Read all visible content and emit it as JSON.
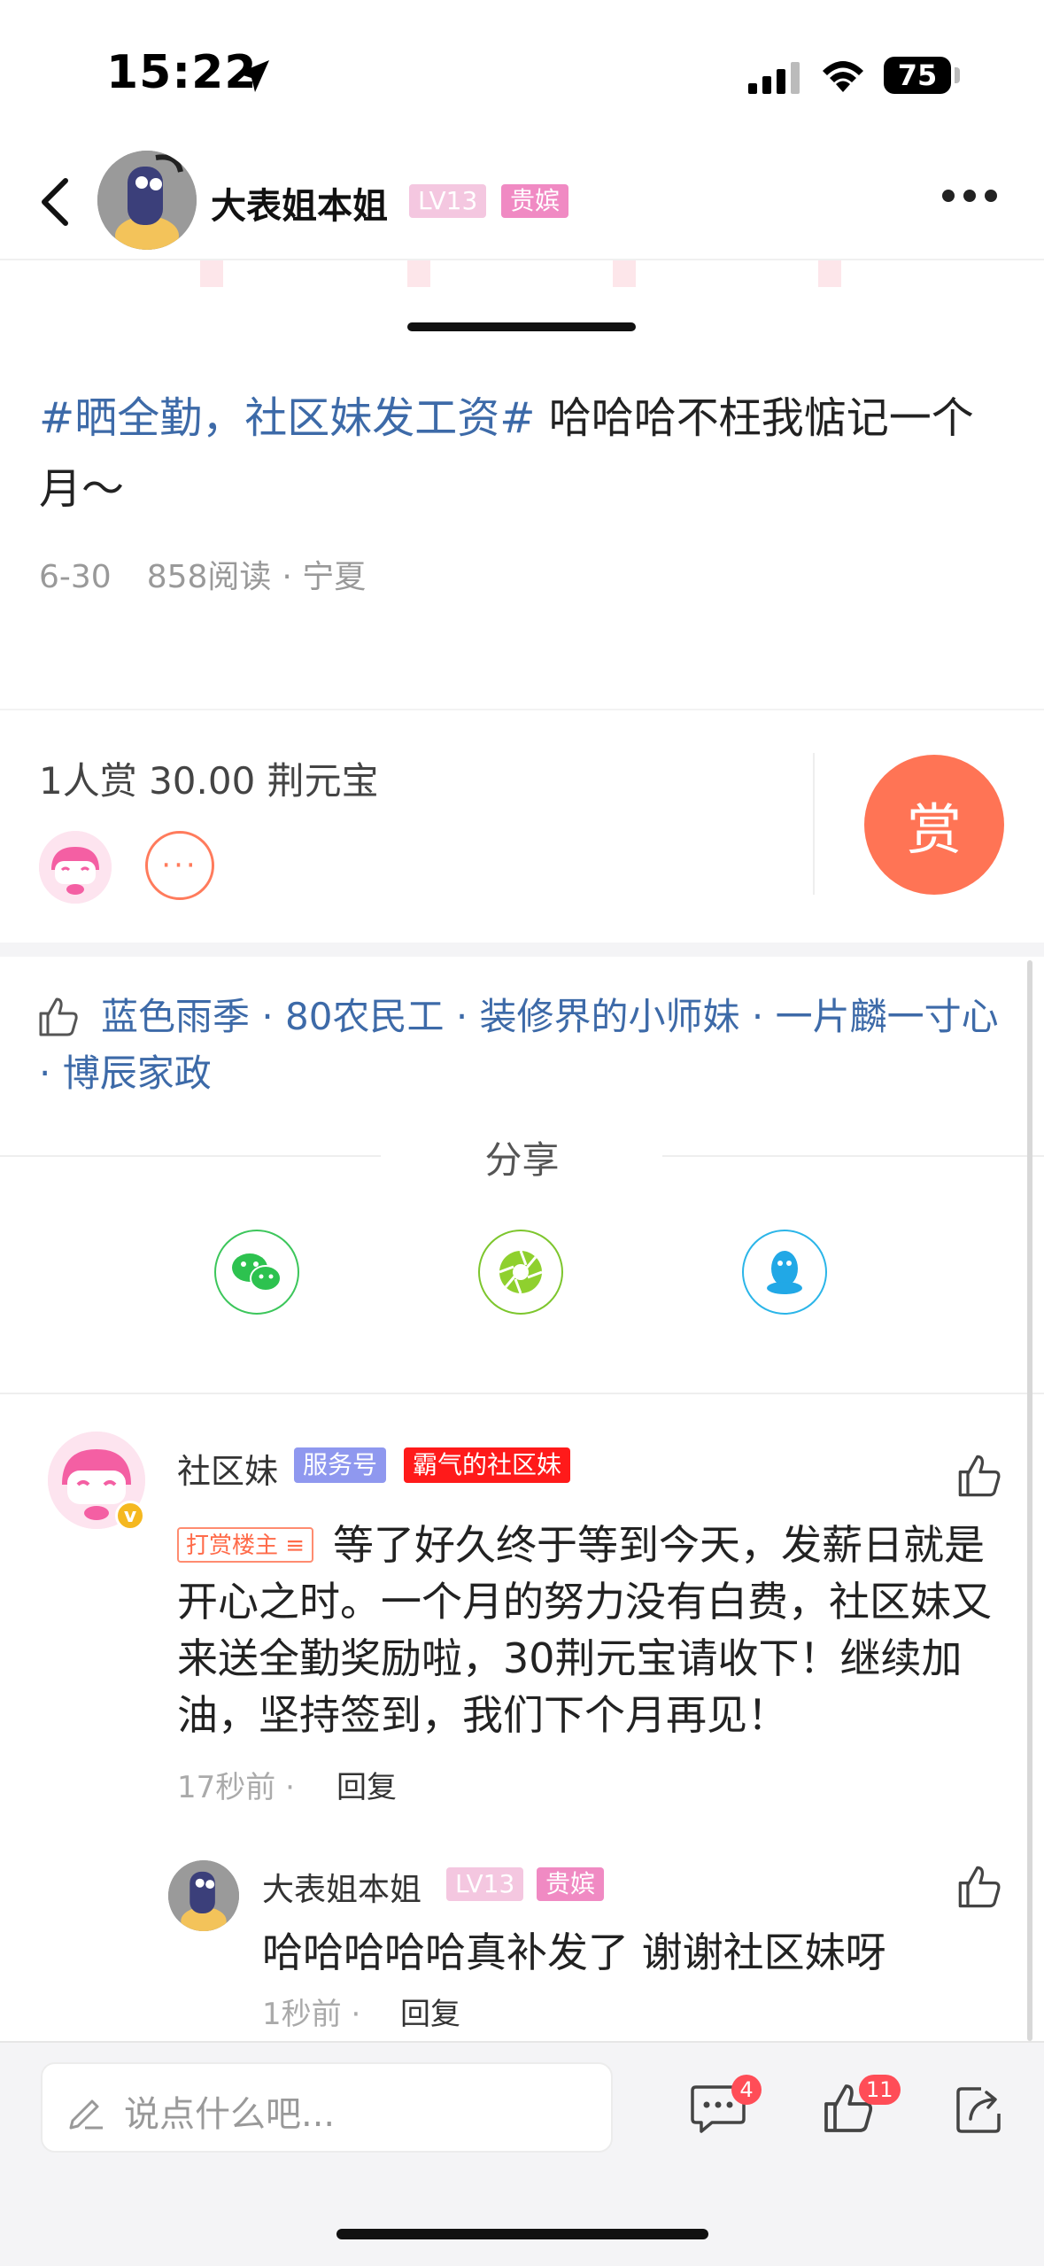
{
  "status_bar": {
    "time": "15:22",
    "battery": "75"
  },
  "header": {
    "name": "大表姐本姐",
    "level_badge": "LV13",
    "title_badge": "贵嫔"
  },
  "post": {
    "hashtag": "#晒全勤，社区妹发工资#",
    "text": " 哈哈哈不枉我惦记一个月～",
    "date": "6-30",
    "reads": "858阅读",
    "location": "· 宁夏"
  },
  "reward": {
    "summary": "1人赏 30.00 荆元宝",
    "button_label": "赏",
    "more_label": "···"
  },
  "likes": {
    "users_text": "蓝色雨季 · 80农民工 · 装修界的小师妹 · 一片麟一寸心 · 博辰家政"
  },
  "share": {
    "title": "分享",
    "targets": [
      "wechat-icon",
      "moments-icon",
      "qq-icon"
    ]
  },
  "comment": {
    "name": "社区妹",
    "service_badge": "服务号",
    "title_badge": "霸气的社区妹",
    "tip_tag": "打赏楼主",
    "text": "等了好久终于等到今天，发薪日就是开心之时。一个月的努力没有白费，社区妹又来送全勤奖励啦，30荆元宝请收下！继续加油，坚持签到，我们下个月再见！",
    "time": "17秒前 ·",
    "reply_label": "回复"
  },
  "reply": {
    "name": "大表姐本姐",
    "level_badge": "LV13",
    "title_badge": "贵嫔",
    "text": "哈哈哈哈哈真补发了 谢谢社区妹呀",
    "time": "1秒前 ·",
    "reply_label": "回复"
  },
  "bottom_bar": {
    "input_placeholder": "说点什么吧...",
    "comment_count": "4",
    "like_count": "11"
  },
  "colors": {
    "tag_blue": "#3d6aa8",
    "reward_orange": "#ff7455",
    "badge_pink": "#f08ac3",
    "service_purple": "#8f98ef",
    "alert_red": "#ff1a1a"
  }
}
